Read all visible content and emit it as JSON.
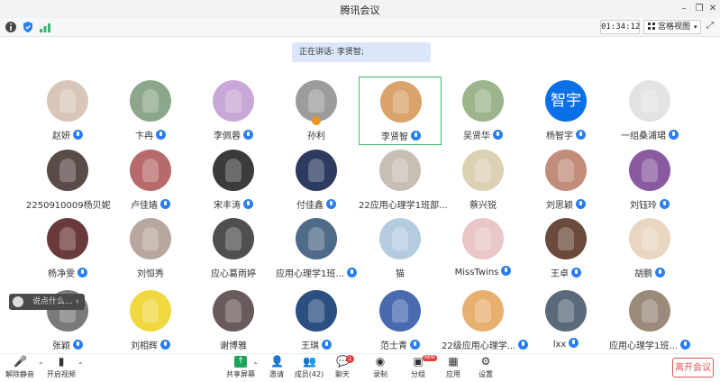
{
  "window": {
    "title": "腾讯会议"
  },
  "toolbar": {
    "timer": "01:34:12",
    "grid_view": "宫格视图"
  },
  "speaking": {
    "text": "正在讲话: 李贤智;"
  },
  "chat": {
    "placeholder": "说点什么..."
  },
  "participants": [
    {
      "name": "赵妍",
      "mic": "on",
      "color": "#d8c7b8"
    },
    {
      "name": "卞冉",
      "mic": "on",
      "color": "#8da78a"
    },
    {
      "name": "李佩蓉",
      "mic": "on",
      "color": "#c9a7d6"
    },
    {
      "name": "孙利",
      "mic": "off",
      "color": "#9c9c9c"
    },
    {
      "name": "李贤智",
      "mic": "on",
      "color": "#d9a36b"
    },
    {
      "name": "吴贤华",
      "mic": "on",
      "color": "#9db58c"
    },
    {
      "name": "杨智宇",
      "mic": "on",
      "color": "#0a70e8",
      "text": "智宇"
    },
    {
      "name": "一组桑浦珺",
      "mic": "on",
      "color": "#e3e3e3"
    },
    {
      "name": "2250910009杨贝妮",
      "mic": "off",
      "color": "#5a4a48"
    },
    {
      "name": "卢佳嫱",
      "mic": "on",
      "color": "#b86a6a"
    },
    {
      "name": "宋丰涛",
      "mic": "on",
      "color": "#3b3b3b"
    },
    {
      "name": "付佳鑫",
      "mic": "on",
      "color": "#2d3b60"
    },
    {
      "name": "22应用心理学1班部...",
      "mic": "off",
      "color": "#c7bfb4"
    },
    {
      "name": "蔡兴锐",
      "mic": "off",
      "color": "#ddd1b5"
    },
    {
      "name": "刘思颖",
      "mic": "on",
      "color": "#c28c7a"
    },
    {
      "name": "刘钰玲",
      "mic": "on",
      "color": "#8a5aa0"
    },
    {
      "name": "杨净雯",
      "mic": "on",
      "color": "#6a3a3a"
    },
    {
      "name": "刘恒秀",
      "mic": "off",
      "color": "#b7a79c"
    },
    {
      "name": "应心葛雨婷",
      "mic": "off",
      "color": "#4f4f4f"
    },
    {
      "name": "应用心理学1班...",
      "mic": "on",
      "color": "#506a8a"
    },
    {
      "name": "猫",
      "mic": "off",
      "color": "#b4cbe0"
    },
    {
      "name": "MissTwins",
      "mic": "on",
      "color": "#e9c7c7"
    },
    {
      "name": "王卓",
      "mic": "on",
      "color": "#6a4a3a"
    },
    {
      "name": "胡鹏",
      "mic": "on",
      "color": "#e8d6c0"
    },
    {
      "name": "张颖",
      "mic": "on",
      "color": "#7a7a7a"
    },
    {
      "name": "刘相辉",
      "mic": "on",
      "color": "#f0d840"
    },
    {
      "name": "谢博雅",
      "mic": "off",
      "color": "#6a5a5a"
    },
    {
      "name": "王琪",
      "mic": "on",
      "color": "#2a4f80"
    },
    {
      "name": "范士青",
      "mic": "on",
      "color": "#4a6ab0"
    },
    {
      "name": "22级应用心理学...",
      "mic": "on",
      "color": "#e8b070"
    },
    {
      "name": "lxx",
      "mic": "on",
      "color": "#5a6a7a"
    },
    {
      "name": "应用心理学1班...",
      "mic": "on",
      "color": "#9a8a7a"
    }
  ],
  "bottom": {
    "unmute": "解除静音",
    "video": "开启视频",
    "share": "共享屏幕",
    "invite": "邀请",
    "members": "成员(42)",
    "chat": "聊天",
    "chat_badge": "1",
    "record": "录制",
    "breakout": "分组",
    "breakout_badge": "NEW",
    "apps": "应用",
    "settings": "设置",
    "leave": "离开会议"
  }
}
